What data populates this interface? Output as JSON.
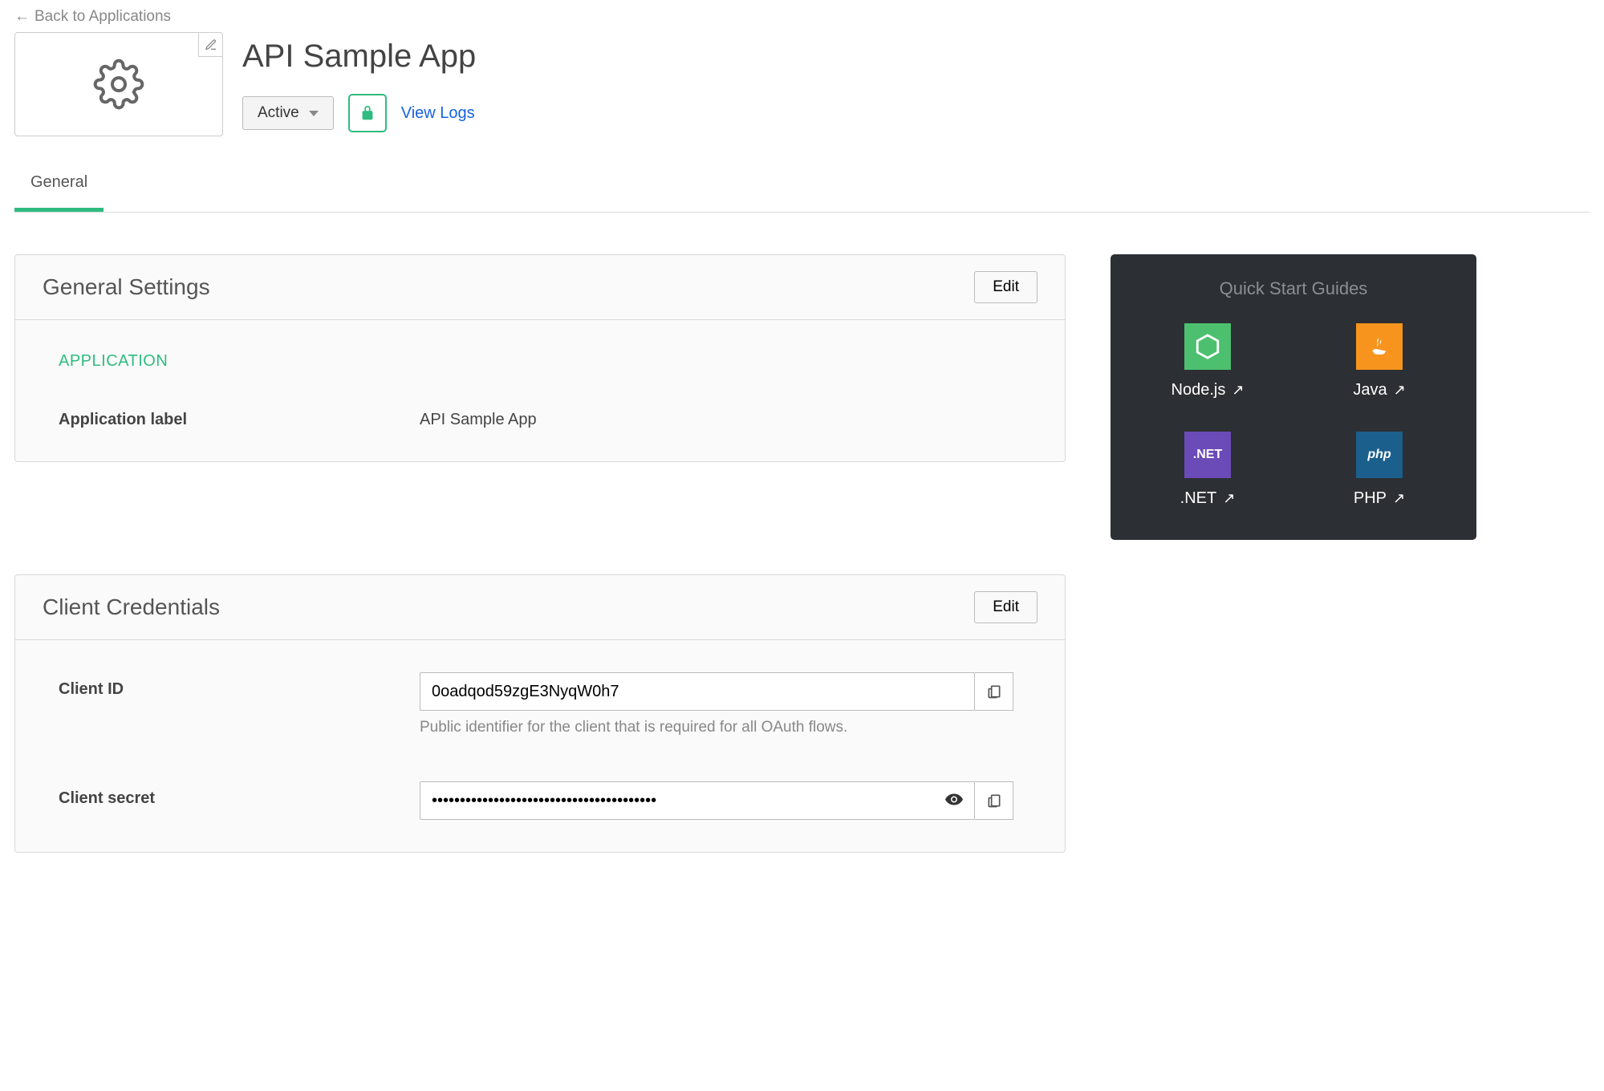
{
  "back_link": "Back to Applications",
  "header": {
    "title": "API Sample App",
    "status": "Active",
    "view_logs": "View Logs"
  },
  "tabs": [
    {
      "label": "General",
      "active": true
    }
  ],
  "general_settings": {
    "panel_title": "General Settings",
    "edit_label": "Edit",
    "section_label": "APPLICATION",
    "fields": {
      "application_label": {
        "label": "Application label",
        "value": "API Sample App"
      }
    }
  },
  "client_credentials": {
    "panel_title": "Client Credentials",
    "edit_label": "Edit",
    "client_id": {
      "label": "Client ID",
      "value": "0oadqod59zgE3NyqW0h7",
      "hint": "Public identifier for the client that is required for all OAuth flows."
    },
    "client_secret": {
      "label": "Client secret",
      "value": "••••••••••••••••••••••••••••••••••••••••"
    }
  },
  "quickstart": {
    "title": "Quick Start Guides",
    "items": [
      {
        "label": "Node.js",
        "kind": "node"
      },
      {
        "label": "Java",
        "kind": "java"
      },
      {
        "label": ".NET",
        "kind": "net"
      },
      {
        "label": "PHP",
        "kind": "php"
      }
    ]
  }
}
